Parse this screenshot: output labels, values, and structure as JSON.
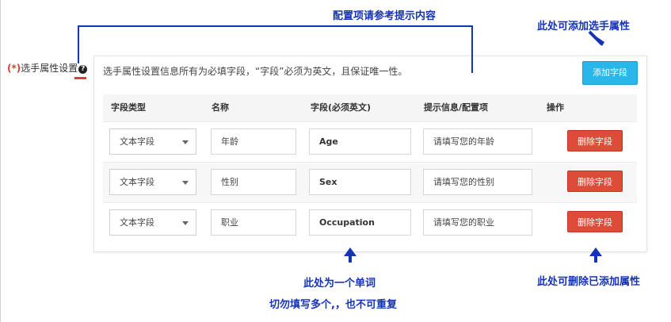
{
  "colors": {
    "annotation": "#1533b5",
    "required": "#e03c31",
    "add_button": "#29b6e8",
    "delete_button": "#dd4b39"
  },
  "field": {
    "required_mark": "(*)",
    "label": "选手属性设置",
    "help_icon": "question-circle-icon"
  },
  "panel": {
    "description": "选手属性设置信息所有为必填字段，“字段”必须为英文，且保证唯一性。",
    "add_button": "添加字段",
    "columns": [
      "字段类型",
      "名称",
      "字段(必须英文)",
      "提示信息/配置项",
      "操作"
    ],
    "rows": [
      {
        "type": "文本字段",
        "name": "年龄",
        "field": "Age",
        "hint": "请填写您的年龄",
        "action": "删除字段"
      },
      {
        "type": "文本字段",
        "name": "性别",
        "field": "Sex",
        "hint": "请填写您的性别",
        "action": "删除字段"
      },
      {
        "type": "文本字段",
        "name": "职业",
        "field": "Occupation",
        "hint": "请填写您的职业",
        "action": "删除字段"
      }
    ]
  },
  "annotations": {
    "config_hint": "配置项请参考提示内容",
    "add_hint": "此处可添加选手属性",
    "word_hint_line1": "此处为一个单词",
    "word_hint_line2": "切勿填写多个,，也不可重复",
    "delete_hint": "此处可删除已添加属性"
  }
}
